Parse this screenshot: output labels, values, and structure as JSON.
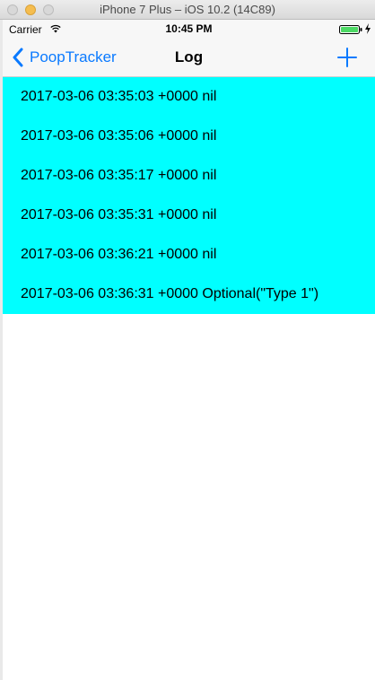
{
  "window": {
    "title": "iPhone 7 Plus – iOS 10.2 (14C89)"
  },
  "status_bar": {
    "carrier": "Carrier",
    "time": "10:45 PM",
    "battery_color": "#4cd964"
  },
  "nav_bar": {
    "back_label": "PoopTracker",
    "title": "Log",
    "add_icon": "plus-icon",
    "tint_color": "#0a7aff"
  },
  "log": {
    "row_color": "#00ffff",
    "entries": [
      "2017-03-06 03:35:03 +0000 nil",
      "2017-03-06 03:35:06 +0000 nil",
      "2017-03-06 03:35:17 +0000 nil",
      "2017-03-06 03:35:31 +0000 nil",
      "2017-03-06 03:36:21 +0000 nil",
      "2017-03-06 03:36:31 +0000 Optional(\"Type 1\")"
    ]
  }
}
